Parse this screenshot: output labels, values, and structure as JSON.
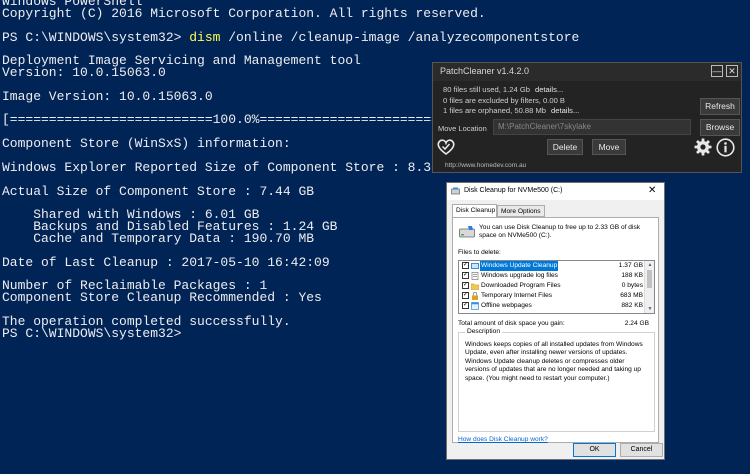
{
  "powershell": {
    "lines": [
      {
        "text": "Windows PowerShell"
      },
      {
        "text": "Copyright (C) 2016 Microsoft Corporation. All rights reserved."
      },
      {
        "text": ""
      },
      {
        "prompt": "PS C:\\WINDOWS\\system32> ",
        "cmd": "dism",
        "args": " /online /cleanup-image /analyzecomponentstore"
      },
      {
        "text": ""
      },
      {
        "text": "Deployment Image Servicing and Management tool"
      },
      {
        "text": "Version: 10.0.15063.0"
      },
      {
        "text": ""
      },
      {
        "text": "Image Version: 10.0.15063.0"
      },
      {
        "text": ""
      },
      {
        "text": "[==========================100.0%==========================]"
      },
      {
        "text": ""
      },
      {
        "text": "Component Store (WinSxS) information:"
      },
      {
        "text": ""
      },
      {
        "text": "Windows Explorer Reported Size of Component Store : 8.30 GB"
      },
      {
        "text": ""
      },
      {
        "text": "Actual Size of Component Store : 7.44 GB"
      },
      {
        "text": ""
      },
      {
        "text": "    Shared with Windows : 6.01 GB"
      },
      {
        "text": "    Backups and Disabled Features : 1.24 GB"
      },
      {
        "text": "    Cache and Temporary Data : 190.70 MB"
      },
      {
        "text": ""
      },
      {
        "text": "Date of Last Cleanup : 2017-05-10 16:42:09"
      },
      {
        "text": ""
      },
      {
        "text": "Number of Reclaimable Packages : 1"
      },
      {
        "text": "Component Store Cleanup Recommended : Yes"
      },
      {
        "text": ""
      },
      {
        "text": "The operation completed successfully."
      },
      {
        "text": "PS C:\\WINDOWS\\system32>"
      }
    ]
  },
  "patchcleaner": {
    "title": "PatchCleaner v1.4.2.0",
    "min_glyph": "—",
    "close_glyph": "✕",
    "info_lines": [
      {
        "text": "80 files still used, 1.24 Gb",
        "link": "details..."
      },
      {
        "text": "0 files are excluded by filters, 0.00 B",
        "link": ""
      },
      {
        "text": "1 files are orphaned, 50.88 Mb",
        "link": "details..."
      }
    ],
    "refresh_label": "Refresh",
    "browse_label": "Browse",
    "move_location_label": "Move Location",
    "move_location_value": "M:\\PatchCleaner\\7skylake",
    "delete_label": "Delete",
    "move_label": "Move",
    "url": "http://www.homedev.com.au",
    "icons": {
      "logo": "heart-logo-icon",
      "settings": "gear-icon",
      "info": "info-icon"
    },
    "colors": {
      "bg": "#232323",
      "button": "#3a3a3a",
      "text": "#cfcfcf"
    }
  },
  "diskcleanup": {
    "title": "Disk Cleanup for NVMe500 (C:)",
    "close_glyph": "✕",
    "tabs": [
      {
        "label": "Disk Cleanup"
      },
      {
        "label": "More Options"
      }
    ],
    "intro": "You can use Disk Cleanup to free up to 2.33 GB of disk space on NVMe500 (C:).",
    "files_label": "Files to delete:",
    "check_glyph": "✓",
    "items": [
      {
        "name": "Windows Update Cleanup",
        "size": "1.37 GB",
        "checked": true,
        "selected": true
      },
      {
        "name": "Windows upgrade log files",
        "size": "188 KB",
        "checked": true,
        "selected": false
      },
      {
        "name": "Downloaded Program Files",
        "size": "0 bytes",
        "checked": true,
        "selected": false
      },
      {
        "name": "Temporary Internet Files",
        "size": "683 MB",
        "checked": true,
        "selected": false
      },
      {
        "name": "Offline webpages",
        "size": "882 KB",
        "checked": true,
        "selected": false
      }
    ],
    "scroll_up": "▲",
    "scroll_down": "▼",
    "total_label": "Total amount of disk space you gain:",
    "total_value": "2.24 GB",
    "description_legend": "Description",
    "description": "Windows keeps copies of all installed updates from Windows Update, even after installing newer versions of updates. Windows Update cleanup deletes or compresses older versions of updates that are no longer needed and taking up space. (You might need to restart your computer.)",
    "how_link": "How does Disk Cleanup work?",
    "ok_label": "OK",
    "cancel_label": "Cancel",
    "colors": {
      "selection": "#0078d7",
      "link": "#0066cc"
    }
  }
}
